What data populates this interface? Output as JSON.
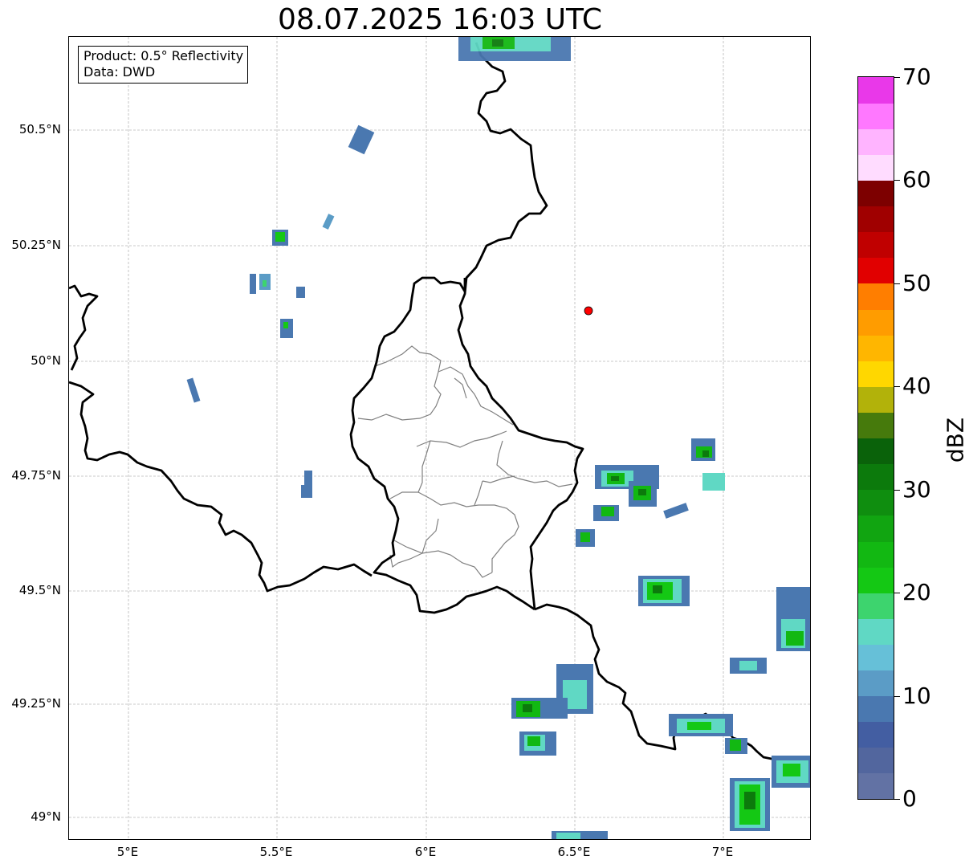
{
  "title": "08.07.2025 16:03 UTC",
  "info": {
    "product": "Product: 0.5° Reflectivity",
    "data": "Data: DWD"
  },
  "axes": {
    "lat_ticks": [
      "50.5°N",
      "50.25°N",
      "50°N",
      "49.75°N",
      "49.5°N",
      "49.25°N",
      "49°N"
    ],
    "lon_ticks": [
      "5°E",
      "5.5°E",
      "6°E",
      "6.5°E",
      "7°E"
    ]
  },
  "colorbar": {
    "unit": "dBZ",
    "min": 0,
    "max": 70,
    "tick_labels": [
      "0",
      "10",
      "20",
      "30",
      "40",
      "50",
      "60",
      "70"
    ],
    "colors": [
      "#6272a4",
      "#52669e",
      "#435ea2",
      "#4a78b0",
      "#5b9cc6",
      "#66c0d8",
      "#60d8c4",
      "#3dd46e",
      "#14c814",
      "#12b812",
      "#11a511",
      "#0f8e0f",
      "#0c7a0c",
      "#0a620a",
      "#467a0c",
      "#b2b20a",
      "#ffd700",
      "#ffb600",
      "#ff9c00",
      "#ff7e00",
      "#e10000",
      "#c00000",
      "#a00000",
      "#7d0000",
      "#ffdcff",
      "#ffb4ff",
      "#ff78ff",
      "#e938e9"
    ]
  },
  "marker": {
    "name": "radar site",
    "color": "#ff0000"
  }
}
